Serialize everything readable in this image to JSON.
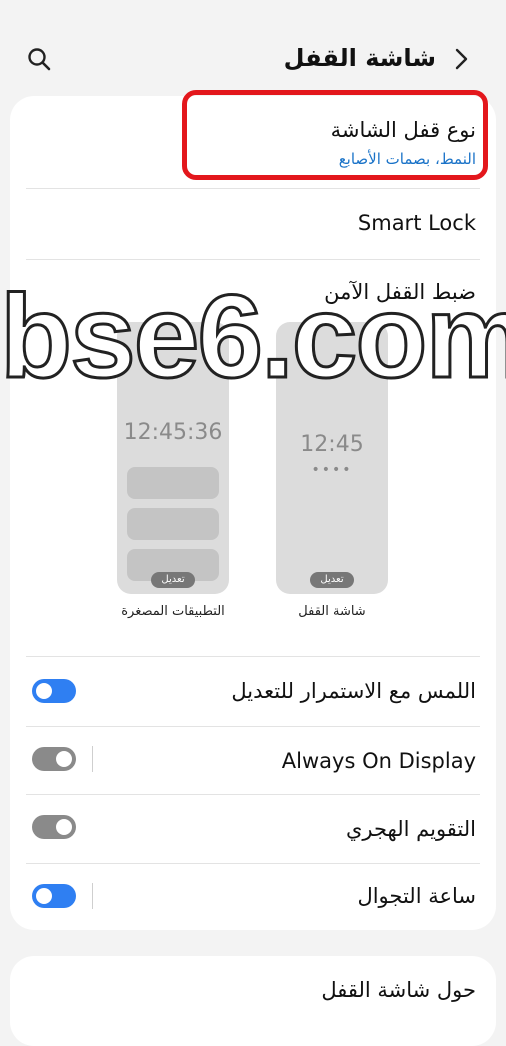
{
  "header": {
    "title": "شاشة القفل"
  },
  "items": {
    "lock_type": {
      "title": "نوع قفل الشاشة",
      "subtitle": "النمط، بصمات الأصابع"
    },
    "smart_lock": {
      "title": "Smart Lock"
    },
    "secure_lock": {
      "title": "ضبط القفل الآمن"
    },
    "touch_hold": {
      "title": "اللمس مع الاستمرار للتعديل",
      "toggle": "on"
    },
    "aod": {
      "title": "Always On Display",
      "toggle": "off"
    },
    "hijri": {
      "title": "التقويم الهجري",
      "toggle": "off"
    },
    "roaming": {
      "title": "ساعة التجوال",
      "toggle": "on"
    },
    "about": {
      "title": "حول شاشة القفل"
    }
  },
  "previews": {
    "widgets": {
      "clock": "12:45:36",
      "edit": "تعديل",
      "caption": "التطبيقات المصغرة"
    },
    "lockscreen": {
      "clock": "12:45",
      "dots": "••••",
      "edit": "تعديل",
      "caption": "شاشة القفل"
    }
  },
  "watermark": "bse6.com",
  "colors": {
    "accent": "#2f7ff2",
    "link": "#1a73c8",
    "highlight": "#e3171c"
  }
}
